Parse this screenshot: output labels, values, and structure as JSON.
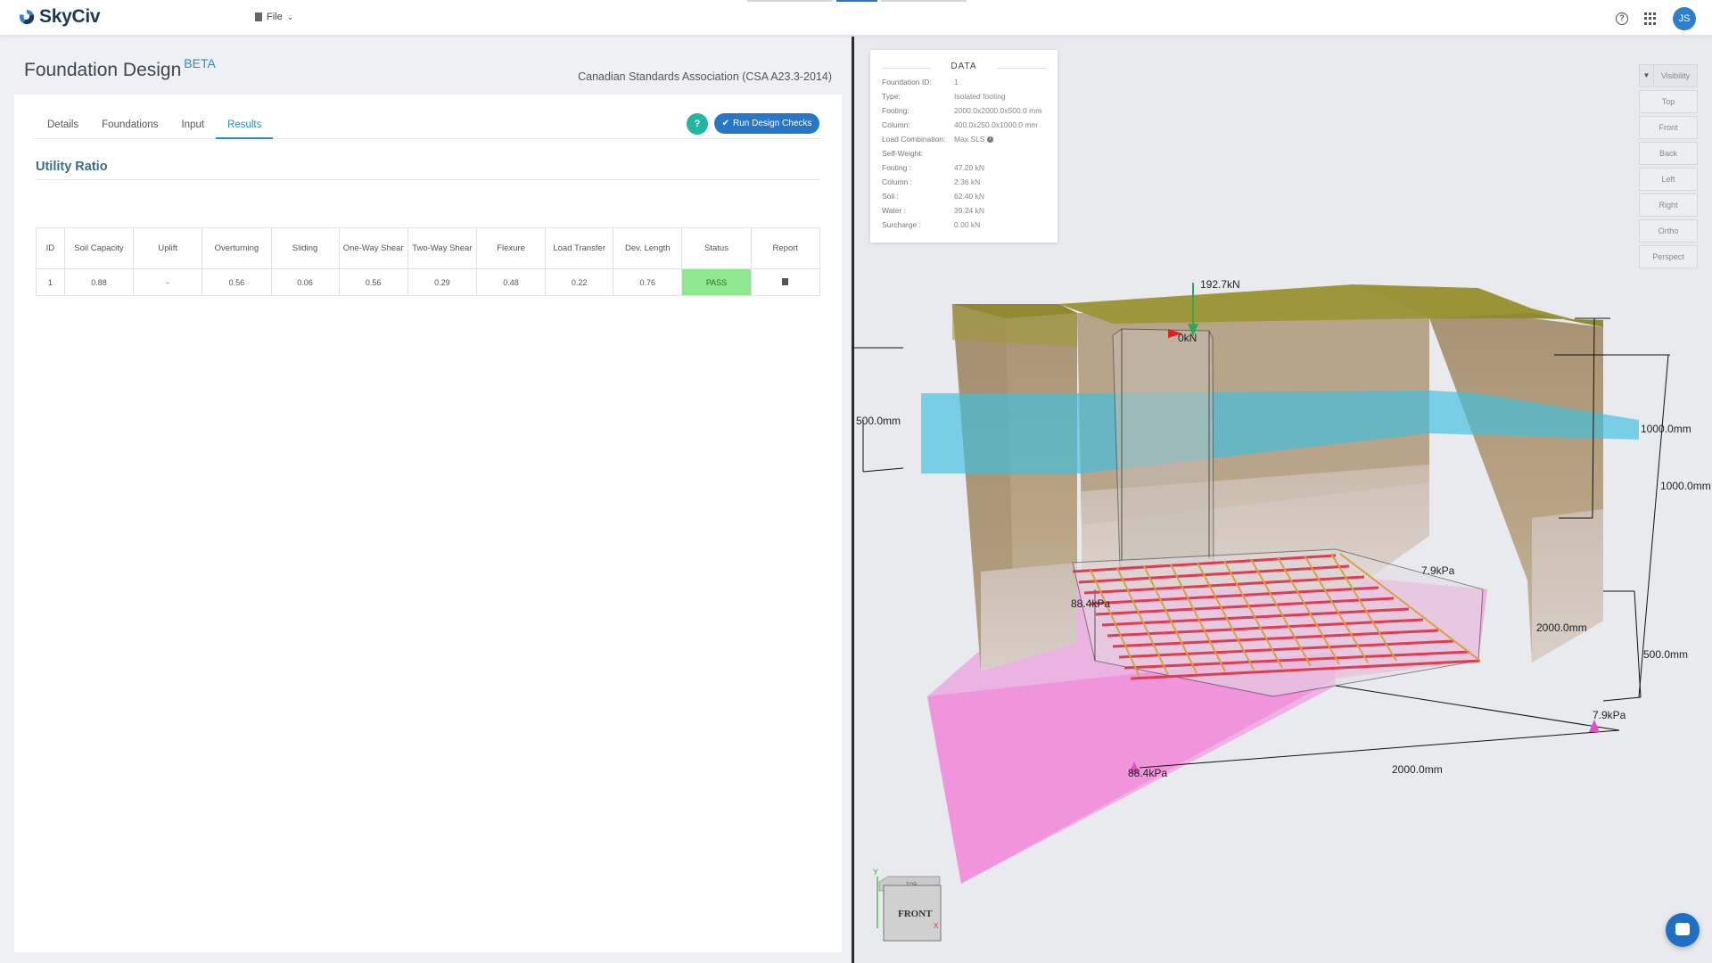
{
  "app": {
    "logo_text": "SkyCiv",
    "file_menu": "File",
    "user_initials": "JS"
  },
  "header": {
    "title": "Foundation Design",
    "badge": "BETA",
    "standard": "Canadian Standards Association (CSA A23.3-2014)"
  },
  "tabs": [
    {
      "label": "Details",
      "active": false
    },
    {
      "label": "Foundations",
      "active": false
    },
    {
      "label": "Input",
      "active": false
    },
    {
      "label": "Results",
      "active": true
    }
  ],
  "actions": {
    "help_label": "?",
    "run_label": "Run Design Checks"
  },
  "results": {
    "section_title": "Utility Ratio",
    "columns": [
      "ID",
      "Soil Capacity",
      "Uplift",
      "Overturning",
      "Sliding",
      "One-Way Shear",
      "Two-Way Shear",
      "Flexure",
      "Load Transfer",
      "Dev. Length",
      "Status",
      "Report"
    ],
    "rows": [
      {
        "id": "1",
        "soil_capacity": "0.88",
        "uplift": "-",
        "overturning": "0.56",
        "sliding": "0.06",
        "one_way_shear": "0.56",
        "two_way_shear": "0.29",
        "flexure": "0.48",
        "load_transfer": "0.22",
        "dev_length": "0.76",
        "status": "PASS"
      }
    ]
  },
  "data_panel": {
    "title": "DATA",
    "foundation_id": {
      "label": "Foundation ID:",
      "value": "1"
    },
    "type": {
      "label": "Type:",
      "value": "Isolated footing"
    },
    "footing": {
      "label": "Footing:",
      "value": "2000.0x2000.0x500.0 mm"
    },
    "column": {
      "label": "Column:",
      "value": "400.0x250.0x1000.0 mm"
    },
    "load_combination": {
      "label": "Load Combination:",
      "value": "Max SLS"
    },
    "self_weight": {
      "label": "Self-Weight:"
    },
    "sw_footing": {
      "label": "Footing :",
      "value": "47.20 kN"
    },
    "sw_column": {
      "label": "Column :",
      "value": "2.36 kN"
    },
    "sw_soil": {
      "label": "Soil :",
      "value": "62.40 kN"
    },
    "sw_water": {
      "label": "Water :",
      "value": "39.24 kN"
    },
    "sw_surcharge": {
      "label": "Surcharge :",
      "value": "0.00 kN"
    }
  },
  "views": [
    "Visibility",
    "Top",
    "Front",
    "Back",
    "Left",
    "Right",
    "Ortho",
    "Perspect"
  ],
  "scene_labels": {
    "axial_load": "192.7kN",
    "moment": "0kN",
    "dim_water_left": "500.0mm",
    "dim_right_1": "1000.0mm",
    "dim_right_2": "1000.0mm",
    "dim_footing_depth": "500.0mm",
    "dim_width_1": "2000.0mm",
    "dim_width_2": "2000.0mm",
    "pressure_max_1": "88.4kPa",
    "pressure_max_2": "88.4kPa",
    "pressure_min_1": "7.9kPa",
    "pressure_min_2": "7.9kPa",
    "cube_face": "FRONT",
    "cube_top": "TOP",
    "axis_y": "Y",
    "axis_x": "X"
  },
  "colors": {
    "accent": "#2b8db8",
    "button": "#2877c7",
    "pass": "#8ee88e",
    "water": "#3cc0e0",
    "pressure": "#f070d0",
    "rebar": "#e03c50"
  }
}
